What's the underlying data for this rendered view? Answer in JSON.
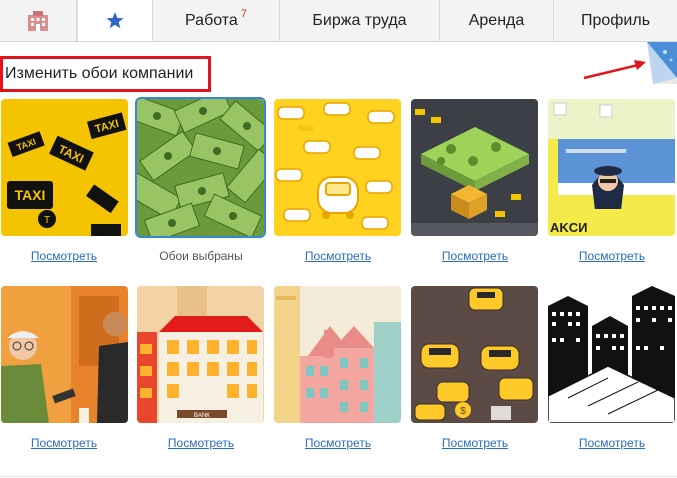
{
  "nav": {
    "work_label": "Работа",
    "work_badge": "7",
    "labor_label": "Биржа труда",
    "rent_label": "Аренда",
    "profile_label": "Профиль"
  },
  "header": {
    "title": "Изменить обои компании"
  },
  "gallery": {
    "wallpapers": [
      {
        "theme": "taxi-signs",
        "action": "Посмотреть"
      },
      {
        "theme": "dollar-bills",
        "action": "Обои выбраны",
        "selected": true
      },
      {
        "theme": "yellow-cars",
        "action": "Посмотреть"
      },
      {
        "theme": "isometric-city",
        "action": "Посмотреть"
      },
      {
        "theme": "taxi-driver",
        "action": "Посмотреть"
      },
      {
        "theme": "office-people",
        "action": "Посмотреть"
      },
      {
        "theme": "bank-building",
        "action": "Посмотреть"
      },
      {
        "theme": "city-towers",
        "action": "Посмотреть"
      },
      {
        "theme": "taxi-cars-dark",
        "action": "Посмотреть"
      },
      {
        "theme": "bw-city",
        "action": "Посмотреть"
      }
    ]
  },
  "colors": {
    "accent": "#3a86d6",
    "link": "#2a6cbf",
    "highlight_frame": "#e2141b",
    "badge": "#d0312d"
  }
}
